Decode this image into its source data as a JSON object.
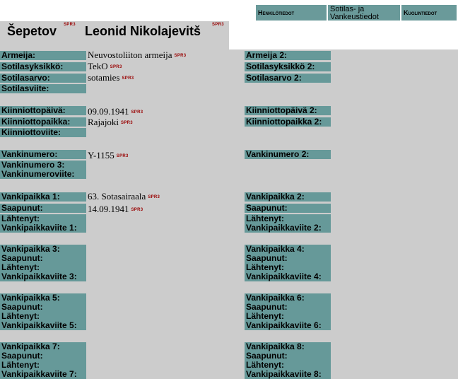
{
  "tabs": {
    "personal": "Henkilötiedot",
    "military_line1": "Sotilas- ja",
    "military_line2": "Vankeustiedot",
    "death": "Kuolintiedot"
  },
  "person": {
    "surname": "Šepetov",
    "firstnames": "Leonid Nikolajevitš",
    "source_tag": "SPR3"
  },
  "labels": {
    "armeija": "Armeija:",
    "sotilasyksikko": "Sotilasyksikkö:",
    "sotilasarvo": "Sotilasarvo:",
    "sotilasviite": "Sotilasviite:",
    "armeija2": "Armeija 2:",
    "sotilasyksikko2": "Sotilasyksikkö 2:",
    "sotilasarvo2": "Sotilasarvo 2:",
    "kiinniottopaiva": "Kiinniottopäivä:",
    "kiinniottopaikka": "Kiinniottopaikka:",
    "kiinniottoviite": "Kiinniottoviite:",
    "kiinniottopaiva2": "Kiinniottopäivä 2:",
    "kiinniottopaikka2": "Kiinniottopaikka 2:",
    "vankinumero": "Vankinumero:",
    "vankinumero3": "Vankinumero 3:",
    "vankinumeroviite": "Vankinumeroviite:",
    "vankinumero2": "Vankinumero 2:",
    "saapunut": "Saapunut:",
    "lahtenyt": "Lähtenyt:",
    "vp1": "Vankipaikka 1:",
    "vpv1": "Vankipaikkaviite 1:",
    "vp2": "Vankipaikka 2:",
    "vpv2": "Vankipaikkaviite 2:",
    "vp3": "Vankipaikka 3:",
    "vpv3": "Vankipaikkaviite 3:",
    "vp4": "Vankipaikka 4:",
    "vpv4": "Vankipaikkaviite 4:",
    "vp5": "Vankipaikka 5:",
    "vpv5": "Vankipaikkaviite 5:",
    "vp6": "Vankipaikka 6:",
    "vpv6": "Vankipaikkaviite 6:",
    "vp7": "Vankipaikka 7:",
    "vpv7": "Vankipaikkaviite 7:",
    "vp8": "Vankipaikka 8:",
    "vpv8": "Vankipaikkaviite 8:"
  },
  "values": {
    "armeija": "Neuvostoliiton armeija",
    "sotilasyksikko": "TekO",
    "sotilasarvo": "sotamies",
    "kiinniottopaiva": "09.09.1941",
    "kiinniottopaikka": "Rajajoki",
    "vankinumero": "Y-1155",
    "vankipaikka1": "63. Sotasairaala",
    "saapunut1": "14.09.1941"
  }
}
